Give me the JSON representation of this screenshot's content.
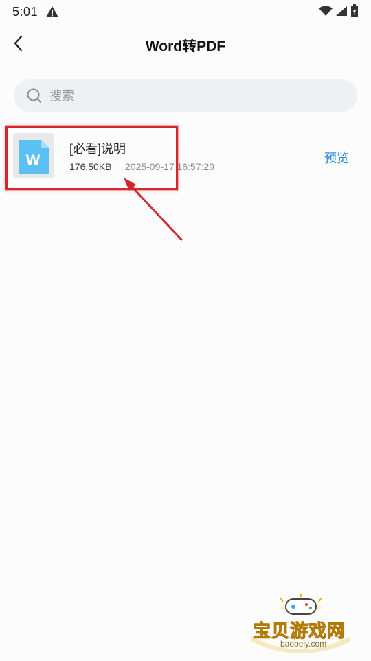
{
  "status_bar": {
    "time": "5:01",
    "icons": [
      "warning-icon",
      "wifi-icon",
      "signal-icon",
      "battery-icon"
    ]
  },
  "header": {
    "title": "Word转PDF",
    "back_icon": "chevron-left-icon"
  },
  "search": {
    "placeholder": "搜索",
    "value": ""
  },
  "files": [
    {
      "name": "[必看]说明",
      "size": "176.50KB",
      "modified": "2025-09-17 16:57:29",
      "icon": "word-doc-icon",
      "icon_letter": "W",
      "action_label": "预览"
    }
  ],
  "watermark": {
    "text": "宝贝游戏网",
    "url": "baobeiy.com"
  },
  "colors": {
    "accent": "#2f8fe0",
    "highlight": "#d6262d",
    "doc_icon": "#5cc0f5",
    "search_bg": "#eef0f2"
  }
}
